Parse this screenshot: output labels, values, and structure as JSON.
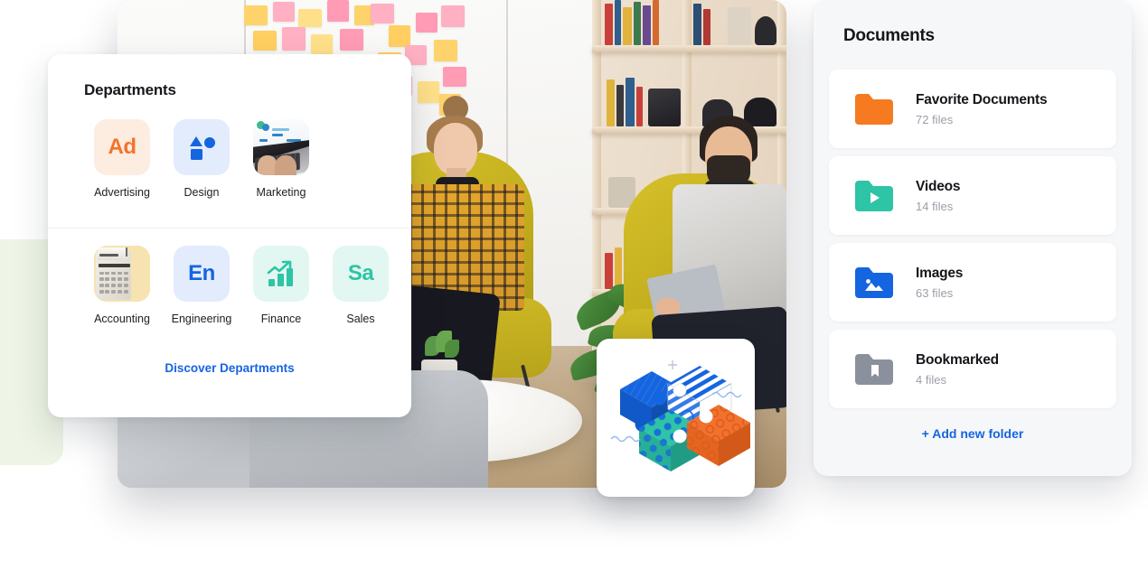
{
  "departments_card": {
    "title": "Departments",
    "link_label": "Discover Departments",
    "items": [
      {
        "label": "Advertising",
        "icon": "ad-badge-icon",
        "badge_text": "Ad",
        "tile_bg": "#fdece0",
        "text_color": "#f4732a"
      },
      {
        "label": "Design",
        "icon": "shapes-icon",
        "badge_text": "",
        "tile_bg": "#e3ecfd",
        "text_color": "#1565e0"
      },
      {
        "label": "Marketing",
        "icon": "laptop-photo-icon",
        "badge_text": "",
        "tile_bg": "#e7f0f5",
        "text_color": "#2e86c8"
      },
      {
        "label": "Accounting",
        "icon": "calculator-photo-icon",
        "badge_text": "",
        "tile_bg": "#f6e3b0",
        "text_color": "#6d6a64"
      },
      {
        "label": "Engineering",
        "icon": "en-badge-icon",
        "badge_text": "En",
        "tile_bg": "#e3ecfd",
        "text_color": "#1565e0"
      },
      {
        "label": "Finance",
        "icon": "bar-chart-up-icon",
        "badge_text": "",
        "tile_bg": "#e2f7f1",
        "text_color": "#2ec4a6"
      },
      {
        "label": "Sales",
        "icon": "sa-badge-icon",
        "badge_text": "Sa",
        "tile_bg": "#e2f7f1",
        "text_color": "#2ec4a6"
      }
    ]
  },
  "documents_panel": {
    "title": "Documents",
    "add_label": "+ Add new folder",
    "folders": [
      {
        "name": "Favorite Documents",
        "count": "72 files",
        "icon": "folder-icon",
        "color": "#f57a20"
      },
      {
        "name": "Videos",
        "count": "14 files",
        "icon": "folder-play-icon",
        "color": "#2ec4a6"
      },
      {
        "name": "Images",
        "count": "63 files",
        "icon": "folder-image-icon",
        "color": "#1565e0"
      },
      {
        "name": "Bookmarked",
        "count": "4 files",
        "icon": "folder-bookmark-icon",
        "color": "#8b919c"
      }
    ]
  },
  "photo_card": {
    "icon": "office-meeting-photo",
    "alt": "Two colleagues seated in yellow armchairs in a bright office with sticky notes on the wall and a bookshelf"
  },
  "puzzle_card": {
    "icon": "isometric-puzzle-illustration",
    "colors": {
      "blue": "#1565e0",
      "teal": "#2ec4a6",
      "orange": "#f2712c"
    }
  },
  "accent_colors": {
    "link_blue": "#1565e0",
    "panel_bg": "#f6f7f9",
    "card_white": "#ffffff",
    "green_peek": "#eef5e6",
    "muted_text": "#9b9fa8"
  }
}
